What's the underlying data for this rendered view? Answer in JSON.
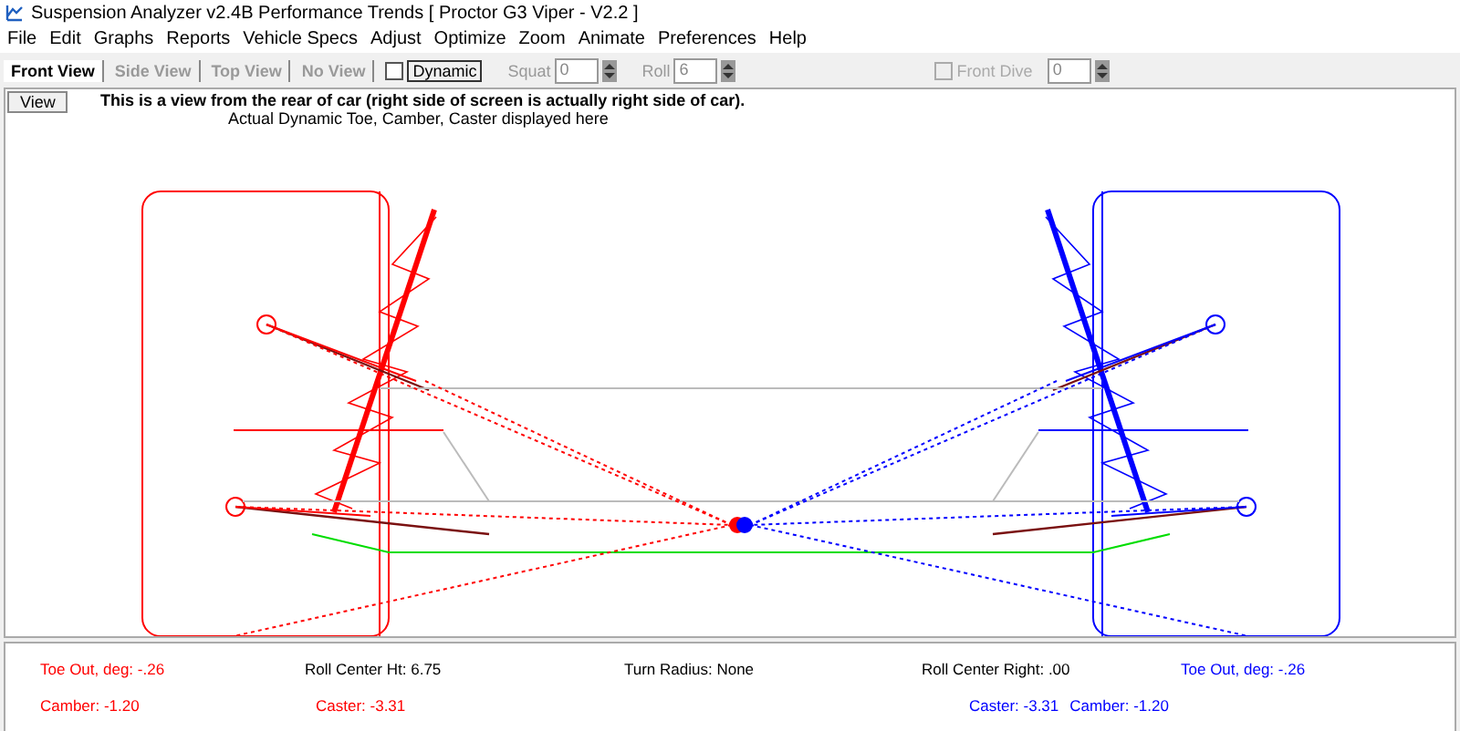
{
  "window": {
    "title": "Suspension Analyzer v2.4B   Performance Trends   [ Proctor G3 Viper - V2.2 ]"
  },
  "menu": [
    "File",
    "Edit",
    "Graphs",
    "Reports",
    "Vehicle Specs",
    "Adjust",
    "Optimize",
    "Zoom",
    "Animate",
    "Preferences",
    "Help"
  ],
  "tabs": [
    {
      "label": "Front View",
      "selected": true
    },
    {
      "label": "Side View",
      "selected": false
    },
    {
      "label": "Top View",
      "selected": false
    },
    {
      "label": "No View",
      "selected": false
    }
  ],
  "dynamic": {
    "label": "Dynamic",
    "checked": false
  },
  "squat": {
    "label": "Squat",
    "value": "0",
    "disabled": true
  },
  "roll": {
    "label": "Roll",
    "value": "6",
    "disabled": true
  },
  "front_dive": {
    "label": "Front Dive",
    "checked": false,
    "disabled": true,
    "value": "0"
  },
  "view_button": "View",
  "heading": "This is a view from the rear of car (right side of screen is actually right side of car).",
  "subheading": "Actual Dynamic Toe, Camber, Caster displayed here",
  "sides": [
    {
      "color": "#ff0000"
    },
    {
      "color": "#0000ff"
    }
  ],
  "readout_rows": [
    [
      {
        "text": "Toe Out, deg: -.26",
        "color": "#ff0000"
      },
      {
        "text": "Roll Center Ht: 6.75",
        "color": "#000000"
      },
      {
        "text": "Turn Radius: None",
        "color": "#000000"
      },
      {
        "text": "Roll Center Right: .00",
        "color": "#000000"
      },
      {
        "text": "Toe Out, deg: -.26",
        "color": "#0000ff"
      }
    ],
    [
      {
        "text": "Camber: -1.20",
        "color": "#ff0000"
      },
      {
        "text": "Caster: -3.31",
        "color": "#ff0000"
      },
      {
        "text": "Caster: -3.31",
        "color": "#0000ff"
      },
      {
        "text": "Camber: -1.20",
        "color": "#0000ff"
      }
    ]
  ]
}
